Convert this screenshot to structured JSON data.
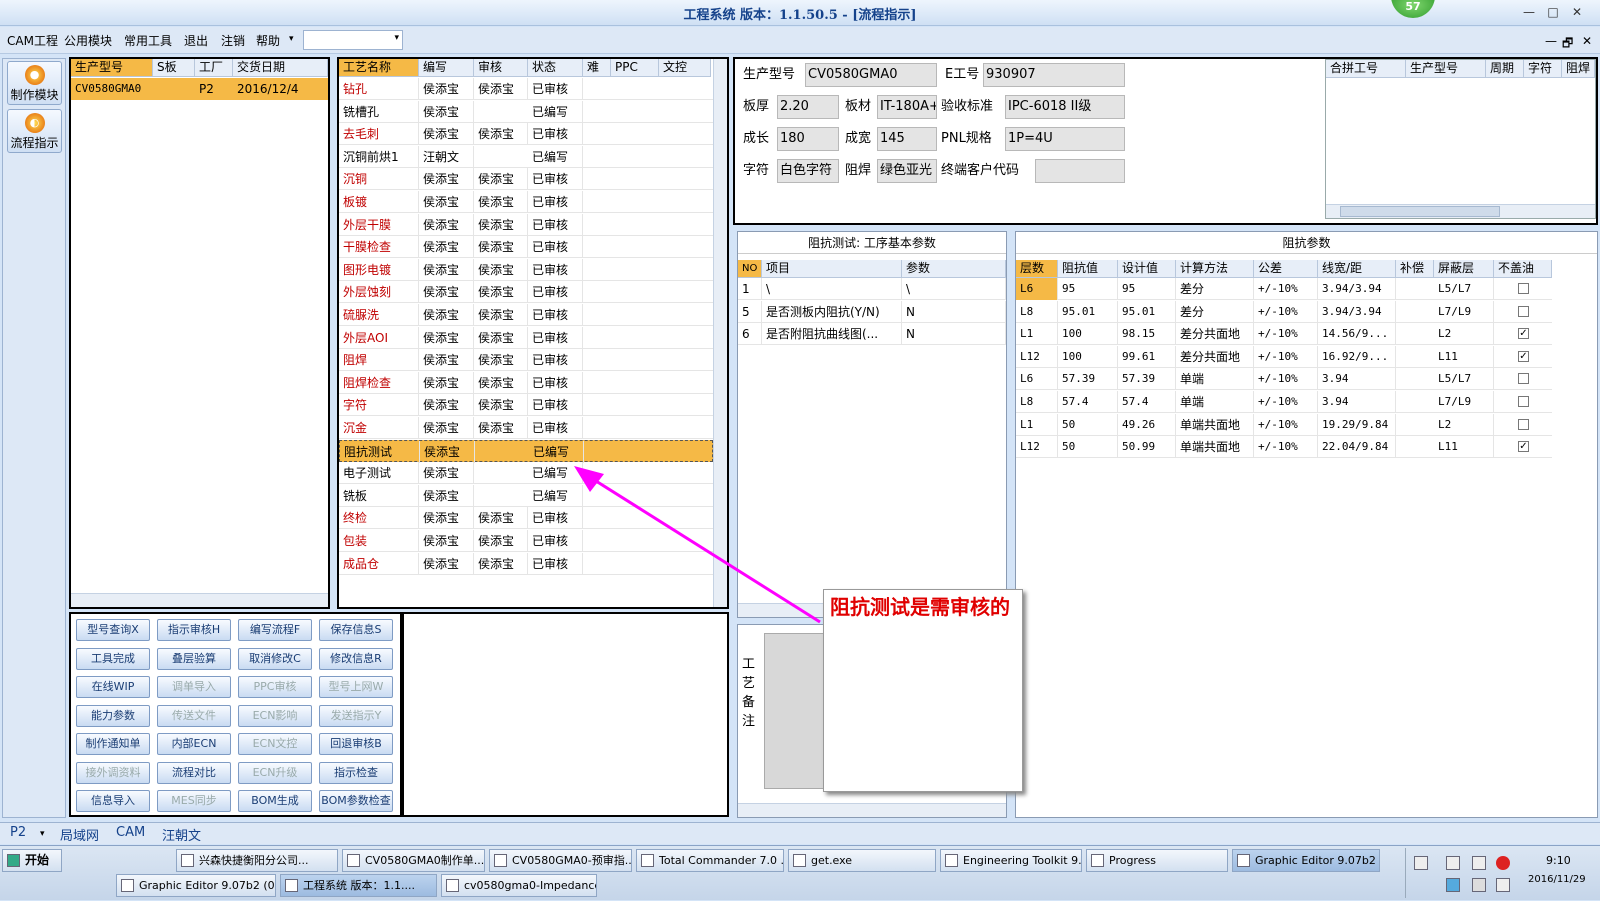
{
  "window": {
    "title": "工程系统  版本：1.1.50.5 - [流程指示]",
    "badge": "57",
    "min": "—",
    "max": "□",
    "close": "✕"
  },
  "menu": {
    "items": [
      "CAM工程",
      "公用模块",
      "常用工具",
      "退出",
      "注销",
      "帮助"
    ],
    "help_arrow": "▾",
    "combo_arrow": "▾",
    "right_controls": [
      "—",
      "🗗",
      "✕"
    ]
  },
  "leftnav": {
    "items": [
      {
        "label": "制作模块",
        "icon": "flame-icon"
      },
      {
        "label": "流程指示",
        "icon": "flow-icon"
      }
    ]
  },
  "orders": {
    "headers": [
      "生产型号",
      "S板",
      "工厂",
      "交货日期"
    ],
    "rows": [
      [
        "CV0580GMA0",
        "",
        "P2",
        "2016/12/4"
      ]
    ]
  },
  "process": {
    "headers": [
      "工艺名称",
      "编写",
      "审核",
      "状态",
      "难",
      "PPC",
      "文控"
    ],
    "rows": [
      [
        "钻孔",
        "侯添宝",
        "侯添宝",
        "已审核"
      ],
      [
        "铣槽孔",
        "侯添宝",
        "",
        "已编写"
      ],
      [
        "去毛刺",
        "侯添宝",
        "侯添宝",
        "已审核"
      ],
      [
        "沉铜前烘1",
        "汪朝文",
        "",
        "已编写"
      ],
      [
        "沉铜",
        "侯添宝",
        "侯添宝",
        "已审核"
      ],
      [
        "板镀",
        "侯添宝",
        "侯添宝",
        "已审核"
      ],
      [
        "外层干膜",
        "侯添宝",
        "侯添宝",
        "已审核"
      ],
      [
        "干膜检查",
        "侯添宝",
        "侯添宝",
        "已审核"
      ],
      [
        "图形电镀",
        "侯添宝",
        "侯添宝",
        "已审核"
      ],
      [
        "外层蚀刻",
        "侯添宝",
        "侯添宝",
        "已审核"
      ],
      [
        "硫脲洗",
        "侯添宝",
        "侯添宝",
        "已审核"
      ],
      [
        "外层AOI",
        "侯添宝",
        "侯添宝",
        "已审核"
      ],
      [
        "阻焊",
        "侯添宝",
        "侯添宝",
        "已审核"
      ],
      [
        "阻焊检查",
        "侯添宝",
        "侯添宝",
        "已审核"
      ],
      [
        "字符",
        "侯添宝",
        "侯添宝",
        "已审核"
      ],
      [
        "沉金",
        "侯添宝",
        "侯添宝",
        "已审核"
      ],
      [
        "阻抗测试",
        "侯添宝",
        "",
        "已编写"
      ],
      [
        "电子测试",
        "侯添宝",
        "",
        "已编写"
      ],
      [
        "铣板",
        "侯添宝",
        "",
        "已编写"
      ],
      [
        "终检",
        "侯添宝",
        "侯添宝",
        "已审核"
      ],
      [
        "包装",
        "侯添宝",
        "侯添宝",
        "已审核"
      ],
      [
        "成品仓",
        "侯添宝",
        "侯添宝",
        "已审核"
      ]
    ],
    "selected_index": 16
  },
  "buttons": [
    [
      "型号查询X",
      "指示审核H",
      "编写流程F",
      "保存信息S"
    ],
    [
      "工具完成",
      "叠层验算",
      "取消修改C",
      "修改信息R"
    ],
    [
      "在线WIP",
      "调单导入",
      "PPC审核",
      "型号上网W"
    ],
    [
      "能力参数",
      "传送文件",
      "ECN影响",
      "发送指示Y"
    ],
    [
      "制作通知单",
      "内部ECN",
      "ECN文控",
      "回退审核B"
    ],
    [
      "接外调资料",
      "流程对比",
      "ECN升级",
      "指示检查"
    ],
    [
      "信息导入",
      "MES同步",
      "BOM生成",
      "BOM参数检查"
    ]
  ],
  "disabled_buttons": [
    "调单导入",
    "PPC审核",
    "型号上网W",
    "传送文件",
    "ECN影响",
    "发送指示Y",
    "ECN文控",
    "接外调资料",
    "ECN升级",
    "MES同步"
  ],
  "info": {
    "model_label": "生产型号",
    "model": "CV0580GMA0",
    "eno_label": "E工号",
    "eno": "930907",
    "thick_label": "板厚",
    "thick": "2.20",
    "material_label": "板材",
    "material": "IT-180A+",
    "std_label": "验收标准",
    "std": "IPC-6018 II级",
    "len_label": "成长",
    "len": "180",
    "wid_label": "成宽",
    "wid": "145",
    "pnl_label": "PNL规格",
    "pnl": "1P=4U",
    "silk_label": "字符",
    "silk": "白色字符",
    "mask_label": "阻焊",
    "mask": "绿色亚光",
    "cust_label": "终端客户代码",
    "cust": ""
  },
  "merge": {
    "headers": [
      "合拼工号",
      "生产型号",
      "周期",
      "字符",
      "阻焊"
    ]
  },
  "test_params": {
    "title": "阻抗测试: 工序基本参数",
    "headers": [
      "NO",
      "项目",
      "参数"
    ],
    "rows": [
      [
        "1",
        "\\",
        "\\"
      ],
      [
        "5",
        "是否测板内阻抗(Y/N)",
        "N"
      ],
      [
        "6",
        "是否附阻抗曲线图(...",
        "N"
      ]
    ]
  },
  "impedance": {
    "title": "阻抗参数",
    "headers": [
      "层数",
      "阻抗值",
      "设计值",
      "计算方法",
      "公差",
      "线宽/距",
      "补偿",
      "屏蔽层",
      "不盖油"
    ],
    "rows": [
      [
        "L6",
        "95",
        "95",
        "差分",
        "+/-10%",
        "3.94/3.94",
        "",
        "L5/L7",
        false
      ],
      [
        "L8",
        "95.01",
        "95.01",
        "差分",
        "+/-10%",
        "3.94/3.94",
        "",
        "L7/L9",
        false
      ],
      [
        "L1",
        "100",
        "98.15",
        "差分共面地",
        "+/-10%",
        "14.56/9...",
        "",
        "L2",
        true
      ],
      [
        "L12",
        "100",
        "99.61",
        "差分共面地",
        "+/-10%",
        "16.92/9...",
        "",
        "L11",
        true
      ],
      [
        "L6",
        "57.39",
        "57.39",
        "单端",
        "+/-10%",
        "3.94",
        "",
        "L5/L7",
        false
      ],
      [
        "L8",
        "57.4",
        "57.4",
        "单端",
        "+/-10%",
        "3.94",
        "",
        "L7/L9",
        false
      ],
      [
        "L1",
        "50",
        "49.26",
        "单端共面地",
        "+/-10%",
        "19.29/9.84",
        "",
        "L2",
        false
      ],
      [
        "L12",
        "50",
        "50.99",
        "单端共面地",
        "+/-10%",
        "22.04/9.84",
        "",
        "L11",
        true
      ]
    ]
  },
  "remarks_label": "工艺备注",
  "callout": "阻抗测试是需审核的",
  "status": {
    "plant": "P2",
    "arrow": "▾",
    "items": [
      "局域网",
      "CAM",
      "汪朝文"
    ]
  },
  "taskbar": {
    "start": "开始",
    "row1": [
      "兴森快捷衡阳分公司...",
      "CV0580GMA0制作单....",
      "CV0580GMA0-预审指...",
      "Total Commander 7.0 ...",
      "get.exe",
      "Engineering Toolkit 9.0...",
      "Progress",
      "Graphic Editor 9.07b2 ..."
    ],
    "row2": [
      "Graphic Editor 9.07b2 (0...",
      "工程系统  版本：1.1....",
      "cv0580gma0-Impedance..."
    ],
    "time": "9:10",
    "date": "2016/11/29"
  },
  "colors": {
    "selected_row": "#f5b946",
    "red_text": "#c00000",
    "callout": "#e00000",
    "arrow": "#ff00ff"
  }
}
